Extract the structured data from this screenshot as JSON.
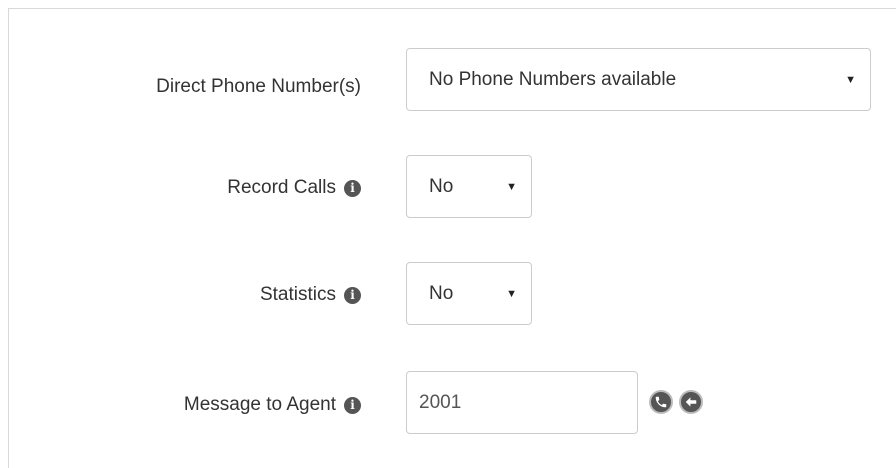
{
  "form": {
    "direct_phone": {
      "label": "Direct Phone Number(s)",
      "selected": "No Phone Numbers available"
    },
    "record_calls": {
      "label": "Record Calls",
      "selected": "No"
    },
    "statistics": {
      "label": "Statistics",
      "selected": "No"
    },
    "message_to_agent": {
      "label": "Message to Agent",
      "value": "2001"
    }
  },
  "icons": {
    "info": "info-icon",
    "dropdown": "caret-down-icon",
    "call": "phone-icon",
    "back": "arrow-left-icon"
  }
}
